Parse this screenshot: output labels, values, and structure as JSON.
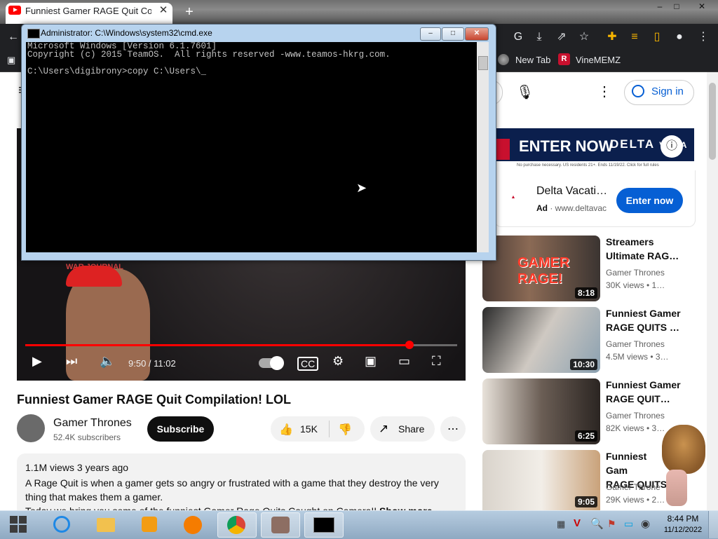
{
  "browser": {
    "tab_title": "Funniest Gamer RAGE Quit Comp",
    "tab_close": "✕",
    "new_tab": "+",
    "window_controls": [
      "–",
      "□",
      "✕"
    ],
    "bookmarks": [
      {
        "label": "New Tab"
      },
      {
        "label": "VineMEMZ"
      }
    ]
  },
  "cmd": {
    "title": "Administrator: C:\\Windows\\system32\\cmd.exe",
    "lines": [
      "Microsoft Windows [Version 6.1.7601]",
      "Copyright (c) 2015 TeamOS.  All rights reserved -www.teamos-hkrg.com.",
      "",
      "C:\\Users\\digibrony>copy C:\\Users\\_"
    ]
  },
  "header": {
    "sign_in": "Sign in"
  },
  "player": {
    "time": "9:50 / 11:02",
    "progress": 0.89,
    "overlay_text": "WAR JOURNAL"
  },
  "video": {
    "title": "Funniest Gamer RAGE Quit Compilation! LOL",
    "channel": "Gamer Thrones",
    "subscribers": "52.4K subscribers",
    "subscribe_label": "Subscribe",
    "likes": "15K",
    "share_label": "Share",
    "views": "1.1M views  3 years ago",
    "description": "A Rage Quit is when a gamer gets so angry or frustrated with a game that they destroy the very thing that makes them a gamer.",
    "description_more": "Today we bring you some of the funniest Gamer Rage Quits Caught on Camera!!",
    "show_more": "Show more"
  },
  "ad": {
    "headline": "ENTER NOW",
    "brand": "DELTA",
    "brand_cut": "VACA",
    "fine_print": "No purchase necessary. US residents 21+. Ends 11/19/22. Click for full rules",
    "title": "Delta Vacati…",
    "badge": "Ad",
    "url": "www.deltavac",
    "button": "Enter now"
  },
  "related": [
    {
      "title_1": "Streamers",
      "title_2": "Ultimate RAG…",
      "channel": "Gamer Thrones",
      "meta": "30K views  • 1…",
      "duration": "8:18",
      "thumb_text": "GAMER RAGE!"
    },
    {
      "title_1": "Funniest Gamer",
      "title_2": "RAGE QUITS …",
      "channel": "Gamer Thrones",
      "meta": "4.5M views  • 3…",
      "duration": "10:30",
      "thumb_text": ""
    },
    {
      "title_1": "Funniest Gamer",
      "title_2": "RAGE QUIT…",
      "channel": "Gamer Thrones",
      "meta": "82K views  • 3…",
      "duration": "6:25",
      "thumb_text": ""
    },
    {
      "title_1": "Funniest Gam",
      "title_2": "RAGE QUITS",
      "channel": "Gamer Throne",
      "meta": "29K views  • 2…",
      "duration": "9:05",
      "thumb_text": ""
    }
  ],
  "taskbar": {
    "time": "8:44 PM",
    "date": "11/12/2022"
  },
  "colors": {
    "youtube_red": "#ff0000",
    "subscribe_bg": "#0f0f0f",
    "ad_button": "#065fd4",
    "chrome_dark": "#202124",
    "taskbar": "#a3bbd2"
  }
}
